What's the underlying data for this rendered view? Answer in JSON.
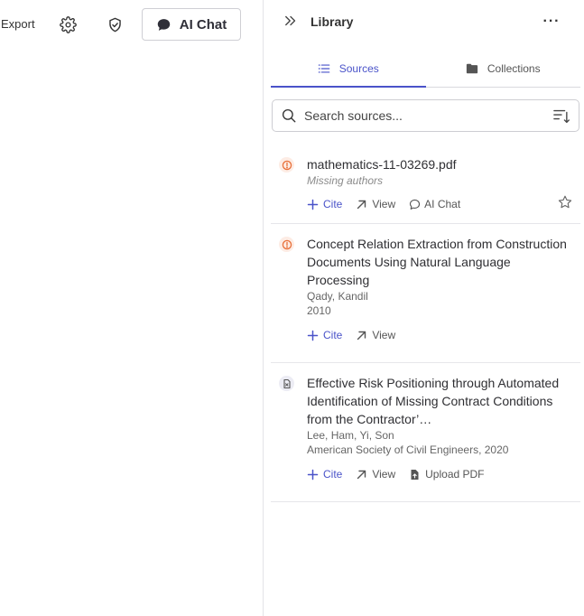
{
  "toolbar": {
    "export_label": "Export",
    "ai_chat_label": "AI Chat",
    "icons": [
      "settings-icon",
      "shield-check-icon",
      "chat-bubble-icon"
    ]
  },
  "library": {
    "title": "Library",
    "tabs": [
      {
        "label": "Sources",
        "icon": "list-icon",
        "active": true
      },
      {
        "label": "Collections",
        "icon": "folder-icon",
        "active": false
      }
    ],
    "search": {
      "placeholder": "Search sources..."
    },
    "sources": [
      {
        "title": "mathematics-11-03269.pdf",
        "meta1": "Missing authors",
        "status_icon": "warning-icon",
        "actions": {
          "cite": "Cite",
          "view": "View",
          "chat": "AI Chat"
        }
      },
      {
        "title": "Concept Relation Extraction from Construction Documents Using Natural Language Processing",
        "authors": "Qady, Kandil",
        "year": "2010",
        "status_icon": "warning-icon",
        "actions": {
          "cite": "Cite",
          "view": "View"
        }
      },
      {
        "title": "Effective Risk Positioning through Automated Identification of Missing Contract Conditions from the Contractor’…",
        "authors": "Lee, Ham, Yi, Son",
        "publisher": "American Society of Civil Engineers, 2020",
        "status_icon": "document-icon",
        "actions": {
          "cite": "Cite",
          "view": "View",
          "upload": "Upload PDF"
        }
      }
    ]
  },
  "colors": {
    "accent": "#4a53c9",
    "warning": "#e8703a"
  }
}
